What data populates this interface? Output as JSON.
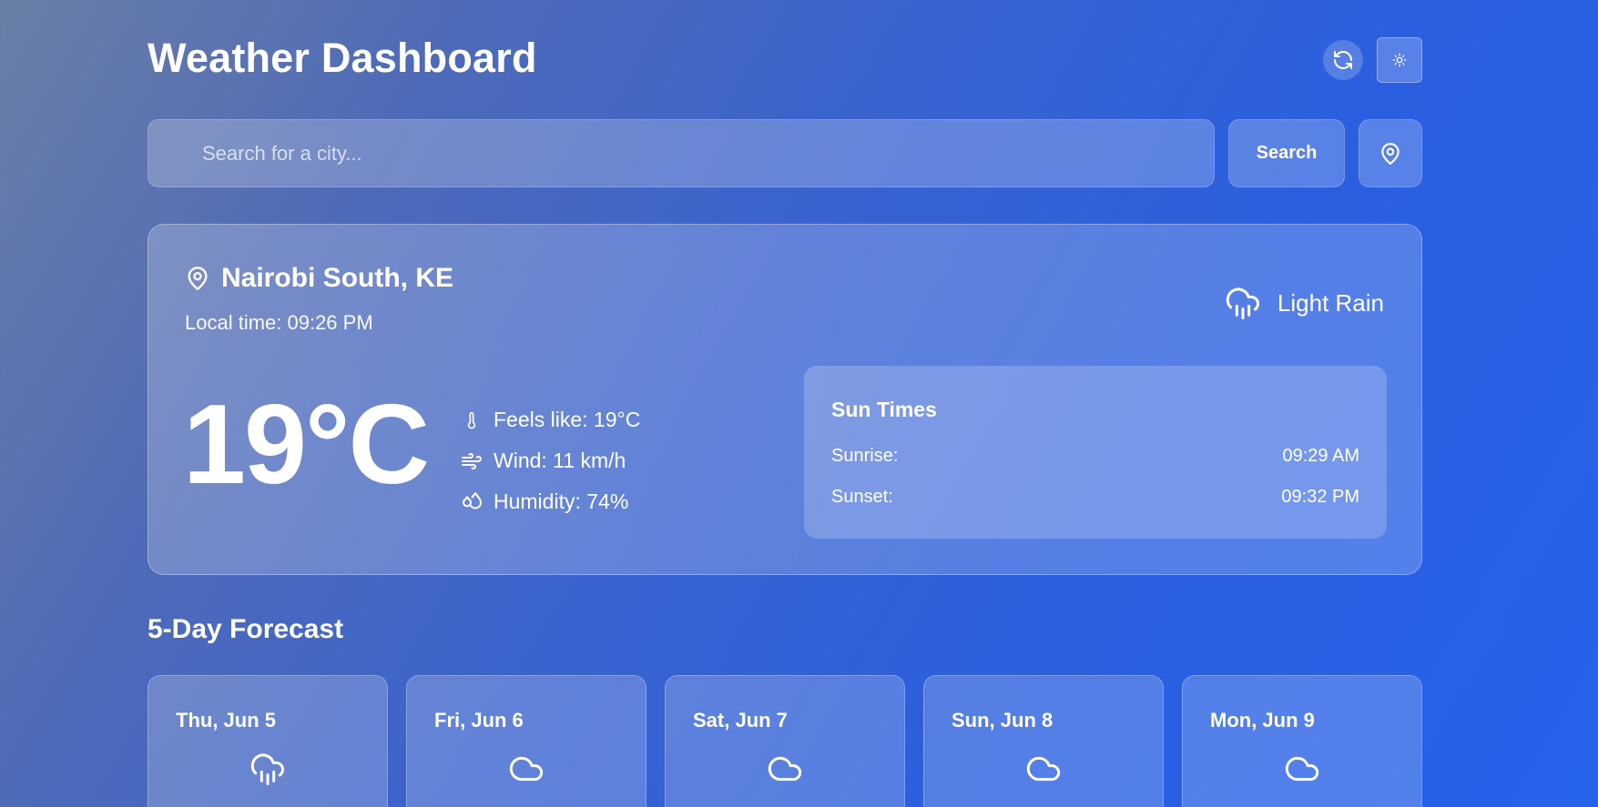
{
  "header": {
    "title": "Weather Dashboard",
    "refresh_icon": "refresh-icon",
    "theme_icon": "sun-icon"
  },
  "search": {
    "placeholder": "Search for a city...",
    "value": "",
    "button_label": "Search",
    "location_icon": "map-pin-icon"
  },
  "current": {
    "location": "Nairobi South, KE",
    "local_time": "Local time: 09:26 PM",
    "condition": "Light Rain",
    "condition_icon": "cloud-rain-icon",
    "temperature": "19°C",
    "feels_like": "Feels like: 19°C",
    "wind": "Wind: 11 km/h",
    "humidity": "Humidity: 74%",
    "sun_times": {
      "title": "Sun Times",
      "sunrise_label": "Sunrise:",
      "sunrise": "09:29 AM",
      "sunset_label": "Sunset:",
      "sunset": "09:32 PM"
    }
  },
  "forecast": {
    "title": "5-Day Forecast",
    "days": [
      {
        "day": "Thu, Jun 5",
        "icon": "cloud-rain-icon"
      },
      {
        "day": "Fri, Jun 6",
        "icon": "cloud-icon"
      },
      {
        "day": "Sat, Jun 7",
        "icon": "cloud-icon"
      },
      {
        "day": "Sun, Jun 8",
        "icon": "cloud-icon"
      },
      {
        "day": "Mon, Jun 9",
        "icon": "cloud-icon"
      }
    ]
  },
  "colors": {
    "accent": "#2563eb",
    "text": "#ffffff"
  }
}
